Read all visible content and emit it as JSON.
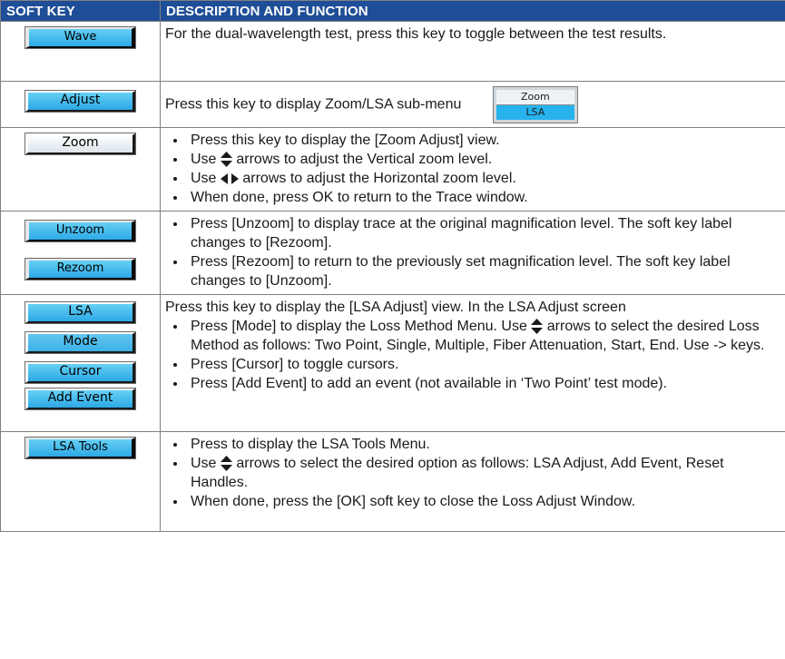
{
  "header": {
    "col1": "SOFT KEY",
    "col2": "DESCRIPTION AND FUNCTION"
  },
  "rows": {
    "wave": {
      "keys": [
        "Wave"
      ],
      "text": "For the dual-wavelength test, press this key to toggle between the test results."
    },
    "adjust": {
      "keys": [
        "Adjust"
      ],
      "text": "Press this key to display Zoom/LSA sub-menu",
      "submenu": [
        "Zoom",
        "LSA"
      ]
    },
    "zoom": {
      "keys": [
        "Zoom"
      ],
      "b1": "Press this key to display the [Zoom Adjust] view.",
      "b2_pre": "Use",
      "b2_post": "arrows to adjust the Vertical zoom level.",
      "b3_pre": "Use",
      "b3_post": "arrows to adjust the Horizontal zoom level.",
      "b4": "When done, press OK to return to the Trace window."
    },
    "unzoom": {
      "keys": [
        "Unzoom",
        "Rezoom"
      ],
      "b1": "Press [Unzoom] to display trace at the original magnification level. The soft key label changes to [Rezoom].",
      "b2": "Press [Rezoom] to return to the previously set magnification level. The soft key label changes to [Unzoom]."
    },
    "lsa": {
      "keys": [
        "LSA",
        "Mode",
        "Cursor",
        "Add Event"
      ],
      "intro": "Press this key to display the [LSA Adjust] view.  In the LSA Adjust screen",
      "b1_pre": "Press [Mode] to display the Loss Method Menu. Use",
      "b1_post": "arrows to select the desired Loss Method as follows: Two Point, Single, Multiple, Fiber Attenuation, Start, End. Use  -> keys.",
      "b2": "Press [Cursor] to toggle cursors.",
      "b3": "Press [Add Event] to add an event (not available in ‘Two Point’ test mode)."
    },
    "lsatools": {
      "keys": [
        "LSA Tools"
      ],
      "b1": "Press to display the LSA Tools Menu.",
      "b2_pre": "Use",
      "b2_post": "arrows to select the desired option as follows: LSA Adjust, Add Event, Reset Handles.",
      "b3": "When done, press the [OK] soft key to close the Loss Adjust Window."
    }
  },
  "colors": {
    "header_bg": "#1f4e98",
    "key_blue": "#2ca8e6",
    "border": "#808080"
  }
}
